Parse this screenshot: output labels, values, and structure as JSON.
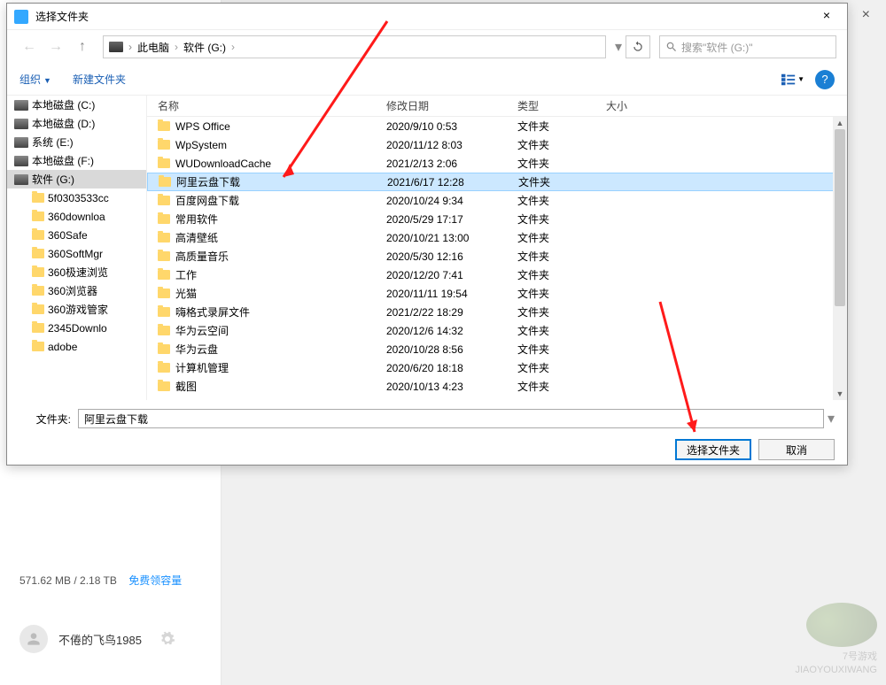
{
  "outer": {
    "close": "×",
    "storage_used": "571.62 MB / 2.18 TB",
    "storage_link": "免费领容量",
    "username": "不倦的飞鸟1985"
  },
  "dialog": {
    "title": "选择文件夹",
    "close": "×"
  },
  "nav": {
    "back": "←",
    "forward": "→",
    "up": "↑",
    "refresh": "↻"
  },
  "breadcrumb": {
    "root": "此电脑",
    "seg1": "软件 (G:)",
    "sep": "›"
  },
  "search": {
    "placeholder": "搜索\"软件 (G:)\""
  },
  "toolbar": {
    "organize": "组织",
    "newfolder": "新建文件夹",
    "help": "?"
  },
  "tree": [
    {
      "label": "本地磁盘 (C:)",
      "icon": "drive",
      "level": 1
    },
    {
      "label": "本地磁盘 (D:)",
      "icon": "drive",
      "level": 1
    },
    {
      "label": "系统 (E:)",
      "icon": "drive",
      "level": 1
    },
    {
      "label": "本地磁盘 (F:)",
      "icon": "drive",
      "level": 1
    },
    {
      "label": "软件 (G:)",
      "icon": "drive",
      "level": 1,
      "selected": true
    },
    {
      "label": "5f0303533cc",
      "icon": "folder",
      "level": 2
    },
    {
      "label": "360downloa",
      "icon": "folder",
      "level": 2
    },
    {
      "label": "360Safe",
      "icon": "folder",
      "level": 2
    },
    {
      "label": "360SoftMgr",
      "icon": "folder",
      "level": 2
    },
    {
      "label": "360极速浏览",
      "icon": "folder",
      "level": 2
    },
    {
      "label": "360浏览器",
      "icon": "folder",
      "level": 2
    },
    {
      "label": "360游戏管家",
      "icon": "folder",
      "level": 2
    },
    {
      "label": "2345Downlo",
      "icon": "folder",
      "level": 2
    },
    {
      "label": "adobe",
      "icon": "folder",
      "level": 2
    }
  ],
  "columns": {
    "name": "名称",
    "date": "修改日期",
    "type": "类型",
    "size": "大小"
  },
  "rows": [
    {
      "name": "WPS Office",
      "date": "2020/9/10 0:53",
      "type": "文件夹"
    },
    {
      "name": "WpSystem",
      "date": "2020/11/12 8:03",
      "type": "文件夹"
    },
    {
      "name": "WUDownloadCache",
      "date": "2021/2/13 2:06",
      "type": "文件夹"
    },
    {
      "name": "阿里云盘下载",
      "date": "2021/6/17 12:28",
      "type": "文件夹",
      "selected": true
    },
    {
      "name": "百度网盘下载",
      "date": "2020/10/24 9:34",
      "type": "文件夹"
    },
    {
      "name": "常用软件",
      "date": "2020/5/29 17:17",
      "type": "文件夹"
    },
    {
      "name": "高清壁纸",
      "date": "2020/10/21 13:00",
      "type": "文件夹"
    },
    {
      "name": "高质量音乐",
      "date": "2020/5/30 12:16",
      "type": "文件夹"
    },
    {
      "name": "工作",
      "date": "2020/12/20 7:41",
      "type": "文件夹"
    },
    {
      "name": "光猫",
      "date": "2020/11/11 19:54",
      "type": "文件夹"
    },
    {
      "name": "嗨格式录屏文件",
      "date": "2021/2/22 18:29",
      "type": "文件夹"
    },
    {
      "name": "华为云空间",
      "date": "2020/12/6 14:32",
      "type": "文件夹"
    },
    {
      "name": "华为云盘",
      "date": "2020/10/28 8:56",
      "type": "文件夹"
    },
    {
      "name": "计算机管理",
      "date": "2020/6/20 18:18",
      "type": "文件夹"
    },
    {
      "name": "截图",
      "date": "2020/10/13 4:23",
      "type": "文件夹"
    }
  ],
  "footer": {
    "label": "文件夹:",
    "value": "阿里云盘下载",
    "select": "选择文件夹",
    "cancel": "取消"
  },
  "watermark": {
    "l1": "7号游戏",
    "l2": "JIAOYOUXIWANG"
  }
}
